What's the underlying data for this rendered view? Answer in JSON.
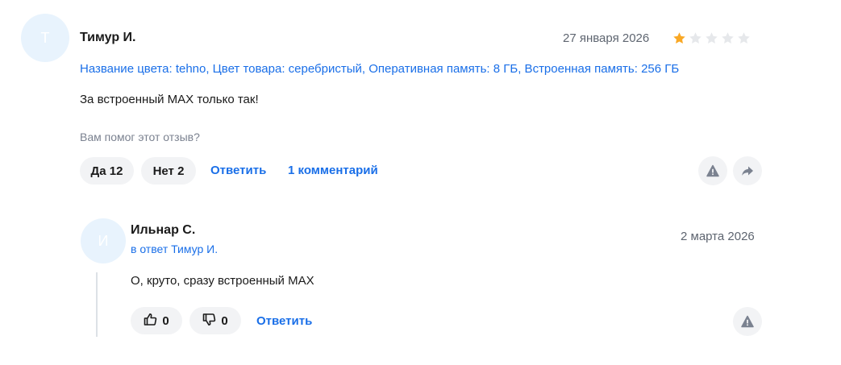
{
  "review": {
    "avatar_letter": "Т",
    "author": "Тимур И.",
    "date": "27 января 2026",
    "rating": 1,
    "rating_max": 5,
    "variant": "Название цвета: tehno, Цвет товара: серебристый, Оперативная память: 8 ГБ, Встроенная память: 256 ГБ",
    "text": "За встроенный MAX только так!",
    "helpful_question": "Вам помог этот отзыв?",
    "yes_label": "Да 12",
    "no_label": "Нет 2",
    "reply_label": "Ответить",
    "comments_label": "1 комментарий",
    "icons": {
      "report": "warning-icon",
      "share": "share-icon"
    }
  },
  "comment": {
    "avatar_letter": "И",
    "author": "Ильнар С.",
    "reply_to": "в ответ Тимур И.",
    "date": "2 марта 2026",
    "text": "О, круто, сразу встроенный MAX",
    "like_count": "0",
    "dislike_count": "0",
    "reply_label": "Ответить",
    "icons": {
      "like": "thumbs-up-icon",
      "dislike": "thumbs-down-icon",
      "report": "warning-icon"
    }
  },
  "colors": {
    "accent": "#1a6fe8",
    "star_active": "#f9a825",
    "star_inactive": "#e6e8eb",
    "avatar_bg": "#e8f3fd",
    "button_bg": "#f2f3f5"
  }
}
